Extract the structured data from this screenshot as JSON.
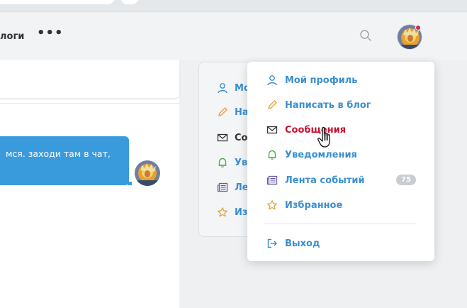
{
  "nav": {
    "label": "логи",
    "more": "•••"
  },
  "chat": {
    "message_text": "мся. заходи там в чат,"
  },
  "sidebar": {
    "items": [
      {
        "label": "Мо",
        "icon": "user-icon",
        "color": "#3a8fcf"
      },
      {
        "label": "На",
        "icon": "pencil-icon",
        "color": "#e6a23c"
      },
      {
        "label": "Со",
        "icon": "envelope-icon",
        "color": "#333333"
      },
      {
        "label": "Ув",
        "icon": "bell-icon",
        "color": "#4caf50"
      },
      {
        "label": "Ле",
        "icon": "feed-icon",
        "color": "#6a5ca8"
      },
      {
        "label": "Из",
        "icon": "star-icon",
        "color": "#e6a23c"
      }
    ]
  },
  "dropdown": {
    "items": [
      {
        "label": "Мой профиль",
        "icon": "user-icon"
      },
      {
        "label": "Написать в блог",
        "icon": "pencil-icon"
      },
      {
        "label": "Сообщения",
        "icon": "envelope-icon",
        "active": true
      },
      {
        "label": "Уведомления",
        "icon": "bell-icon"
      },
      {
        "label": "Лента событий",
        "icon": "feed-icon",
        "badge": "75"
      },
      {
        "label": "Избранное",
        "icon": "star-icon"
      }
    ],
    "logout": {
      "label": "Выход",
      "icon": "logout-icon"
    }
  },
  "colors": {
    "link_blue": "#3a8fcf",
    "active_red": "#c8102e",
    "bubble_blue": "#3a9bdc",
    "notification_red": "#e02633",
    "badge_gray": "#c9ccd0"
  }
}
